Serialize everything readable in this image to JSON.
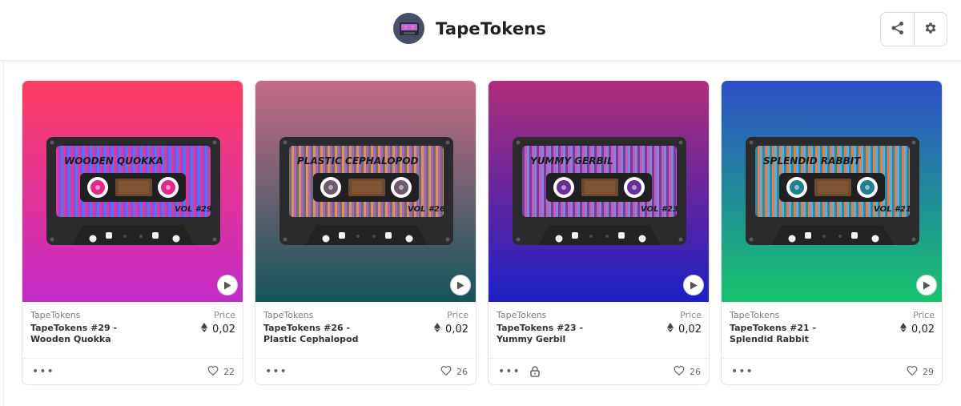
{
  "header": {
    "brand_name": "TapeTokens",
    "logo_icon": "cassette-logo-icon",
    "actions": [
      {
        "icon": "share-icon"
      },
      {
        "icon": "gear-icon"
      }
    ]
  },
  "cards": [
    {
      "collection": "TapeTokens",
      "title": "TapeTokens #29 - Wooden Quokka",
      "price_label": "Price",
      "price": "0,02",
      "likes": "22",
      "tape_name": "WOODEN QUOKKA",
      "vol": "VOL #29",
      "locked": false,
      "bg_top": "#ff3d63",
      "bg_bottom": "#c22bc9",
      "reel_color": "#e6268a",
      "stripe_a": "#8e3bd9",
      "stripe_b": "#3d6cff"
    },
    {
      "collection": "TapeTokens",
      "title": "TapeTokens #26 - Plastic Cephalopod",
      "price_label": "Price",
      "price": "0,02",
      "likes": "26",
      "tape_name": "PLASTIC CEPHALOPOD",
      "vol": "VOL #26",
      "locked": false,
      "bg_top": "#c76a86",
      "bg_bottom": "#13565a",
      "reel_color": "#6b5a6b",
      "stripe_a": "#d88a4a",
      "stripe_b": "#9a5db8"
    },
    {
      "collection": "TapeTokens",
      "title": "TapeTokens #23 - Yummy Gerbil",
      "price_label": "Price",
      "price": "0,02",
      "likes": "26",
      "tape_name": "YUMMY GERBIL",
      "vol": "VOL #23",
      "locked": true,
      "bg_top": "#b02d7a",
      "bg_bottom": "#1c20c4",
      "reel_color": "#6a2c9a",
      "stripe_a": "#c24fb0",
      "stripe_b": "#7a7ad8"
    },
    {
      "collection": "TapeTokens",
      "title": "TapeTokens #21 - Splendid Rabbit",
      "price_label": "Price",
      "price": "0,02",
      "likes": "29",
      "tape_name": "SPLENDID RABBIT",
      "vol": "VOL #21",
      "locked": false,
      "bg_top": "#2d4fc7",
      "bg_bottom": "#17c46e",
      "reel_color": "#1f7f93",
      "stripe_a": "#e0743a",
      "stripe_b": "#4fa6d8"
    }
  ]
}
